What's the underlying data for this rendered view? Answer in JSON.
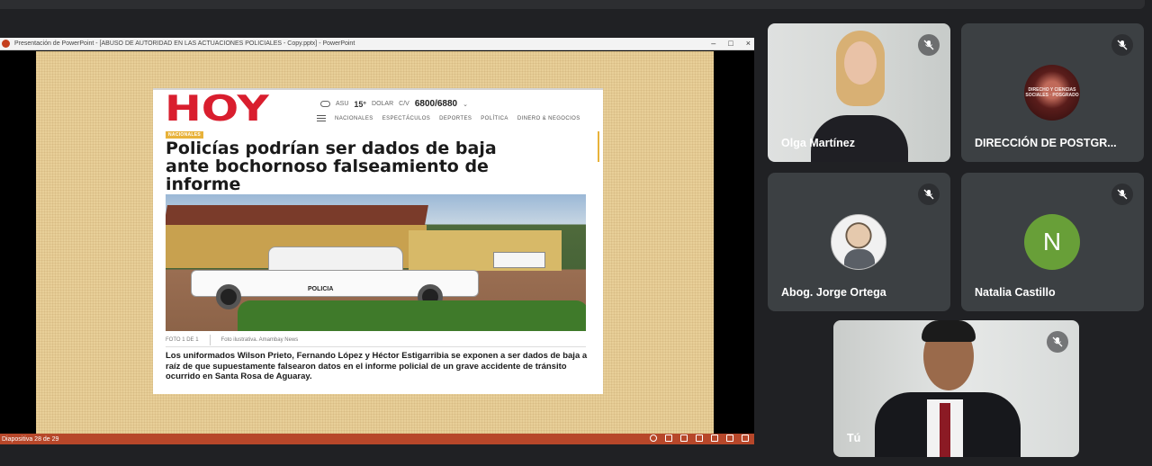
{
  "window": {
    "title": "Presentación de PowerPoint - [ABUSO DE AUTORIDAD EN LAS ACTUACIONES POLICIALES - Copy.pptx] - PowerPoint",
    "controls": [
      "–",
      "□",
      "×"
    ],
    "status_left": "Diapositiva 28 de 29"
  },
  "slide": {
    "logo": "HOY",
    "weather": {
      "label": "ASU",
      "temperature": "15°",
      "currency_label": "DOLAR",
      "cv_label": "C/V",
      "exchange_rate": "6800/6880"
    },
    "nav_items": [
      "NACIONALES",
      "ESPECTÁCULOS",
      "DEPORTES",
      "POLÍTICA",
      "DINERO & NEGOCIOS"
    ],
    "section_tag": "NACIONALES",
    "headline": "Policías podrían ser dados de baja ante bochornoso falseamiento de informe",
    "photo_counter": "FOTO 1 DE 1",
    "photo_credit": "Foto ilustrativa. Amambay News",
    "truck_label": "POLICIA",
    "lede": "Los uniformados Wilson Prieto, Fernando López y Héctor Estigarribia se exponen a ser dados de baja a raíz de que supuestamente falsearon datos en el informe policial de un grave accidente de tránsito ocurrido en Santa Rosa de Aguaray."
  },
  "participants": [
    {
      "name": "Olga Martínez",
      "type": "video",
      "muted": true
    },
    {
      "name": "DIRECCIÓN DE POSTGR...",
      "type": "logo",
      "logo_text": "DIRECHO Y CIENCIAS SOCIALES · POSGRADO",
      "muted": true
    },
    {
      "name": "Abog. Jorge Ortega",
      "type": "photo",
      "muted": true
    },
    {
      "name": "Natalia Castillo",
      "type": "initial",
      "initial": "N",
      "avatar_color": "#689f38",
      "muted": true
    },
    {
      "name": "Tú",
      "type": "video",
      "muted": true
    }
  ],
  "colors": {
    "background": "#202124",
    "tile": "#3c4043",
    "powerpoint_status": "#b7472a",
    "hoy_red": "#d91e2e",
    "tag_yellow": "#e8b23a"
  }
}
